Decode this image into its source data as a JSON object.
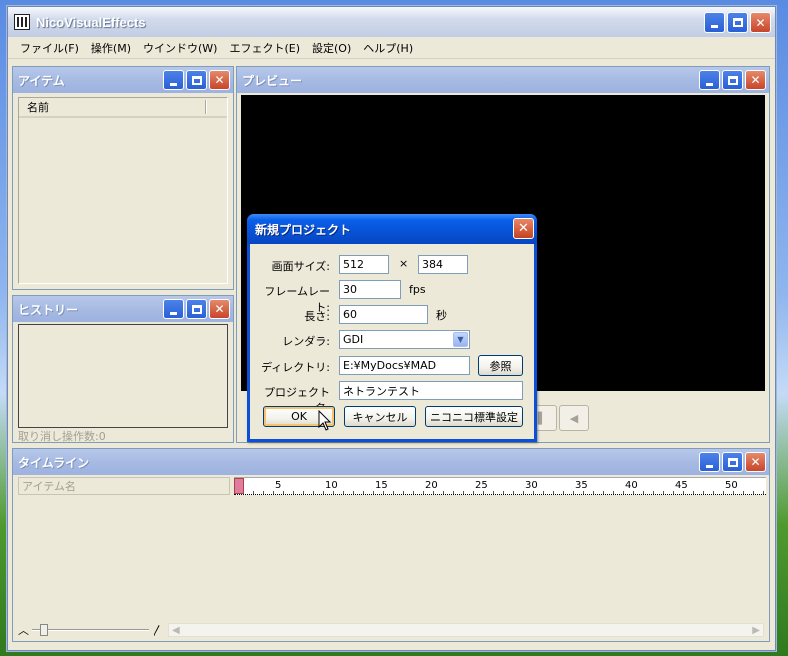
{
  "app": {
    "title": "NicoVisualEffects"
  },
  "menu": {
    "items": [
      "ファイル(F)",
      "操作(M)",
      "ウインドウ(W)",
      "エフェクト(E)",
      "設定(O)",
      "ヘルプ(H)"
    ]
  },
  "items_panel": {
    "title": "アイテム",
    "column_header": "名前"
  },
  "history_panel": {
    "title": "ヒストリー",
    "status": "取り消し操作数:0"
  },
  "preview_panel": {
    "title": "プレビュー"
  },
  "timeline_panel": {
    "title": "タイムライン",
    "name_column": "アイテム名",
    "ticks": [
      "5",
      "10",
      "15",
      "20",
      "25",
      "30",
      "35",
      "40",
      "45",
      "50"
    ]
  },
  "dialog": {
    "title": "新規プロジェクト",
    "close_label": "✕",
    "screen_size_label": "画面サイズ:",
    "width_value": "512",
    "times_sign": "×",
    "height_value": "384",
    "framerate_label": "フレームレート:",
    "framerate_value": "30",
    "framerate_unit": "fps",
    "length_label": "長さ:",
    "length_value": "60",
    "length_unit": "秒",
    "renderer_label": "レンダラ:",
    "renderer_value": "GDI",
    "directory_label": "ディレクトリ:",
    "directory_value": "E:¥MyDocs¥MAD",
    "browse_label": "参照",
    "project_name_label": "プロジェクト名:",
    "project_name_value": "ネトランテスト",
    "ok_label": "OK",
    "cancel_label": "キャンセル",
    "default_label": "ニコニコ標準設定"
  },
  "colors": {
    "dialog_title": "#0752d6",
    "timeline_cursor": "#e07ca0"
  }
}
